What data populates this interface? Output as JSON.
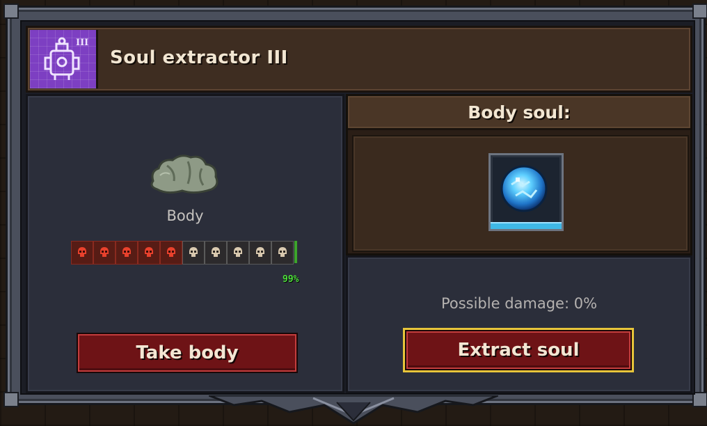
{
  "header": {
    "title": "Soul extractor III",
    "icon": "soul-extractor-blueprint-icon",
    "icon_tier": "III"
  },
  "left_panel": {
    "item_label": "Body",
    "item_icon": "corpse-body-icon",
    "quality_bar": {
      "red_skulls": 5,
      "total_skulls": 10,
      "percent_text": "99%",
      "percent_value": 99
    },
    "button_label": "Take body"
  },
  "right_panel": {
    "header": "Body soul:",
    "soul_icon": "blue-soul-orb-icon",
    "damage_text": "Possible damage: 0%",
    "button_label": "Extract soul"
  },
  "colors": {
    "button_red": "#6e1316",
    "highlight_gold": "#e7c53a",
    "icon_purple": "#7d3fc2",
    "percent_green": "#4de03a",
    "soul_blue": "#3fb8e6"
  }
}
